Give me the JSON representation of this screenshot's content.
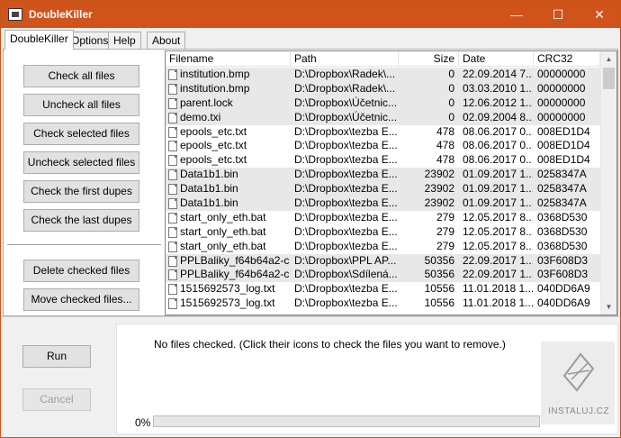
{
  "window": {
    "title": "DoubleKiller",
    "controls": {
      "minimize": "—",
      "maximize": "☐",
      "close": "✕"
    }
  },
  "tabs": [
    "DoubleKiller",
    "Options",
    "Help",
    "About"
  ],
  "left_buttons": {
    "check_all": "Check all files",
    "uncheck_all": "Uncheck all files",
    "check_selected": "Check selected files",
    "uncheck_selected": "Uncheck selected files",
    "check_first_dupes": "Check the first dupes",
    "check_last_dupes": "Check the last dupes",
    "delete_checked": "Delete checked files",
    "move_checked": "Move checked files..."
  },
  "columns": [
    "Filename",
    "Path",
    "Size",
    "Date",
    "CRC32"
  ],
  "rows": [
    {
      "filename": "institution.bmp",
      "path": "D:\\Dropbox\\Radek\\...",
      "size": "0",
      "date": "22.09.2014 7...",
      "crc": "00000000",
      "shade": "grey"
    },
    {
      "filename": "institution.bmp",
      "path": "D:\\Dropbox\\Radek\\...",
      "size": "0",
      "date": "03.03.2010 1...",
      "crc": "00000000",
      "shade": "grey"
    },
    {
      "filename": "parent.lock",
      "path": "D:\\Dropbox\\Účetnic...",
      "size": "0",
      "date": "12.06.2012 1...",
      "crc": "00000000",
      "shade": "grey"
    },
    {
      "filename": "demo.txi",
      "path": "D:\\Dropbox\\Účetnic...",
      "size": "0",
      "date": "02.09.2004 8...",
      "crc": "00000000",
      "shade": "grey"
    },
    {
      "filename": "epools_etc.txt",
      "path": "D:\\Dropbox\\tezba E...",
      "size": "478",
      "date": "08.06.2017 0...",
      "crc": "008ED1D4",
      "shade": "white"
    },
    {
      "filename": "epools_etc.txt",
      "path": "D:\\Dropbox\\tezba E...",
      "size": "478",
      "date": "08.06.2017 0...",
      "crc": "008ED1D4",
      "shade": "white"
    },
    {
      "filename": "epools_etc.txt",
      "path": "D:\\Dropbox\\tezba E...",
      "size": "478",
      "date": "08.06.2017 0...",
      "crc": "008ED1D4",
      "shade": "white"
    },
    {
      "filename": "Data1b1.bin",
      "path": "D:\\Dropbox\\tezba E...",
      "size": "23902",
      "date": "01.09.2017 1...",
      "crc": "0258347A",
      "shade": "grey"
    },
    {
      "filename": "Data1b1.bin",
      "path": "D:\\Dropbox\\tezba E...",
      "size": "23902",
      "date": "01.09.2017 1...",
      "crc": "0258347A",
      "shade": "grey"
    },
    {
      "filename": "Data1b1.bin",
      "path": "D:\\Dropbox\\tezba E...",
      "size": "23902",
      "date": "01.09.2017 1...",
      "crc": "0258347A",
      "shade": "grey"
    },
    {
      "filename": "start_only_eth.bat",
      "path": "D:\\Dropbox\\tezba E...",
      "size": "279",
      "date": "12.05.2017 8...",
      "crc": "0368D530",
      "shade": "white"
    },
    {
      "filename": "start_only_eth.bat",
      "path": "D:\\Dropbox\\tezba E...",
      "size": "279",
      "date": "12.05.2017 8...",
      "crc": "0368D530",
      "shade": "white"
    },
    {
      "filename": "start_only_eth.bat",
      "path": "D:\\Dropbox\\tezba E...",
      "size": "279",
      "date": "12.05.2017 8...",
      "crc": "0368D530",
      "shade": "white"
    },
    {
      "filename": "PPLBaliky_f64b64a2-c...",
      "path": "D:\\Dropbox\\PPL AP...",
      "size": "50356",
      "date": "22.09.2017 1...",
      "crc": "03F608D3",
      "shade": "grey"
    },
    {
      "filename": "PPLBaliky_f64b64a2-c...",
      "path": "D:\\Dropbox\\Sdílená...",
      "size": "50356",
      "date": "22.09.2017 1...",
      "crc": "03F608D3",
      "shade": "grey"
    },
    {
      "filename": "1515692573_log.txt",
      "path": "D:\\Dropbox\\tezba E...",
      "size": "10556",
      "date": "11.01.2018 1...",
      "crc": "040DD6A9",
      "shade": "white"
    },
    {
      "filename": "1515692573_log.txt",
      "path": "D:\\Dropbox\\tezba E...",
      "size": "10556",
      "date": "11.01.2018 1...",
      "crc": "040DD6A9",
      "shade": "white"
    }
  ],
  "bottom": {
    "run": "Run",
    "cancel": "Cancel",
    "status": "No files checked. (Click their icons to check the files you want to remove.)",
    "progress_label": "0%",
    "progress_value": 0
  },
  "watermark": "INSTALUJ.CZ",
  "colors": {
    "titlebar": "#d0531b",
    "grey_row": "#e8e8e8"
  }
}
